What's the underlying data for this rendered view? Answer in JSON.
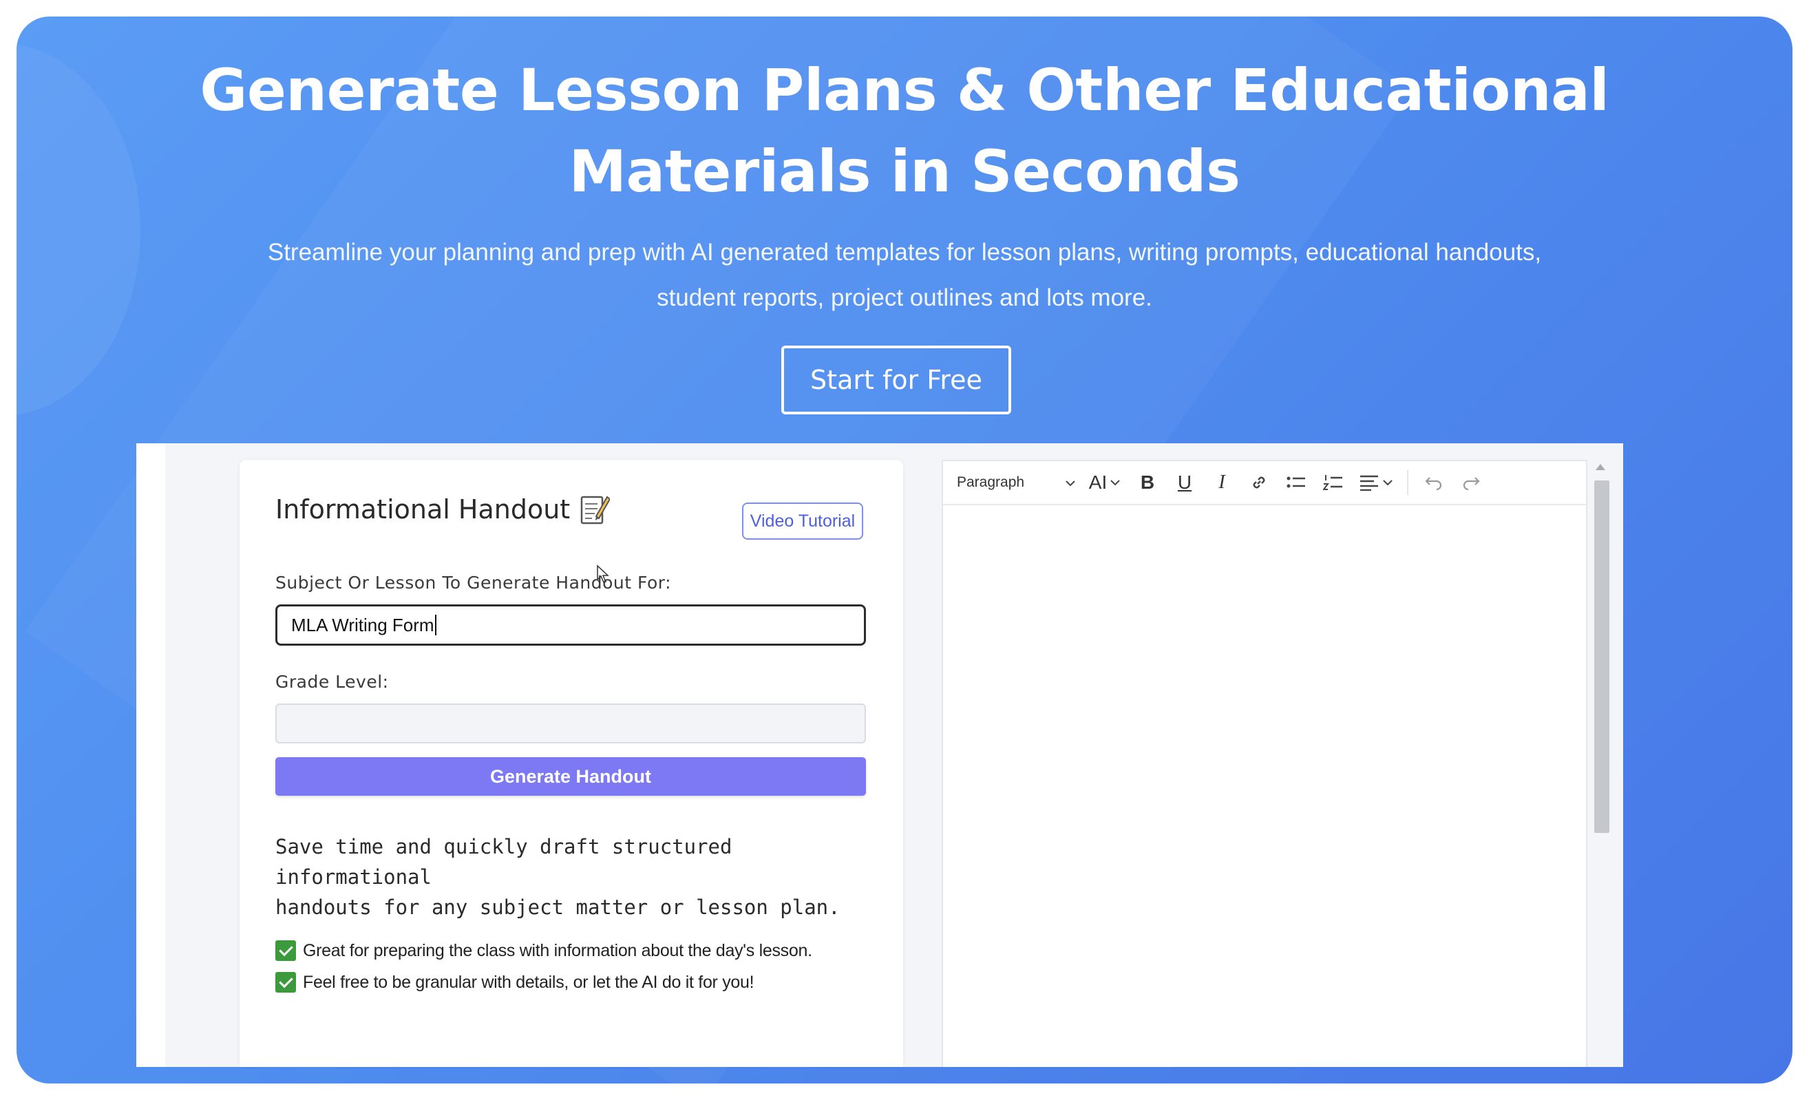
{
  "hero": {
    "title_line1": "Generate Lesson Plans & Other Educational",
    "title_line2": "Materials in Seconds",
    "subtitle_line1": "Streamline your planning and prep with AI generated templates for lesson plans, writing prompts, educational handouts,",
    "subtitle_line2": "student reports, project outlines and lots more.",
    "cta_label": "Start for Free"
  },
  "form": {
    "title": "Informational Handout",
    "title_icon": "memo-icon",
    "video_button": "Video Tutorial",
    "subject_label": "Subject Or Lesson To Generate Handout For:",
    "subject_value": "MLA Writing Form",
    "grade_label": "Grade Level:",
    "grade_value": "",
    "generate_button": "Generate Handout",
    "description_line1": "Save time and quickly draft structured informational",
    "description_line2": "handouts for any subject matter or lesson plan.",
    "bullets": [
      "Great for preparing the class with information about the day's lesson.",
      "Feel free to be granular with details, or let the AI do it for you!"
    ]
  },
  "editor": {
    "block_format": "Paragraph",
    "font_size_label": "AI",
    "bold_label": "B",
    "underline_label": "U",
    "italic_label": "I",
    "content": ""
  },
  "colors": {
    "hero_gradient_start": "#5b9cf5",
    "hero_gradient_end": "#4776e6",
    "generate_button": "#7d78f4",
    "check": "#3c9a3c",
    "video_button_border": "#7d8fe8"
  }
}
